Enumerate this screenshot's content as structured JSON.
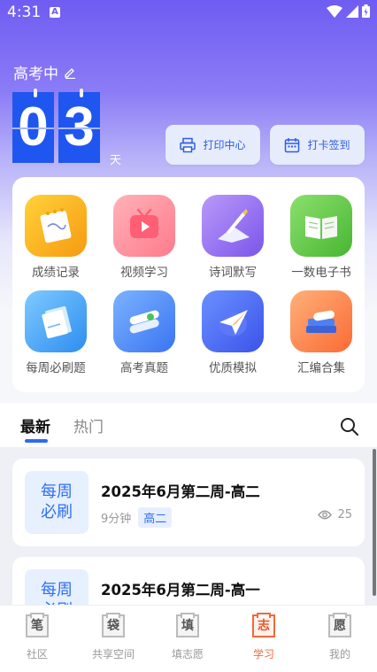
{
  "status_bar": {
    "time": "4:31",
    "notification_glyph": "A"
  },
  "countdown": {
    "title": "高考中",
    "digit_1": "0",
    "digit_2": "3",
    "unit": "天"
  },
  "top_buttons": {
    "print_center": "打印中心",
    "checkin": "打卡签到"
  },
  "grid": {
    "items": [
      {
        "label": "成绩记录",
        "icon": "notepad-icon",
        "color": "#f7b418"
      },
      {
        "label": "视频学习",
        "icon": "tv-play-icon",
        "color": "#ff8a9a"
      },
      {
        "label": "诗词默写",
        "icon": "quill-icon",
        "color": "#9a73f2"
      },
      {
        "label": "一数电子书",
        "icon": "open-book-icon",
        "color": "#5fc44a"
      },
      {
        "label": "每周必刷题",
        "icon": "paper-stack-icon",
        "color": "#3aa6f4"
      },
      {
        "label": "高考真题",
        "icon": "scroll-icon",
        "color": "#3f7ff5"
      },
      {
        "label": "优质模拟",
        "icon": "paper-plane-icon",
        "color": "#4c6ff5"
      },
      {
        "label": "汇编合集",
        "icon": "books-icon",
        "color": "#fb7a45"
      }
    ]
  },
  "tabs": {
    "latest": "最新",
    "hot": "热门"
  },
  "list": [
    {
      "badge": "每周\n必刷",
      "title": "2025年6月第二周-高二",
      "duration": "9分钟",
      "grade": "高二",
      "views": "25"
    },
    {
      "badge": "每周\n必刷",
      "title": "2025年6月第二周-高一"
    }
  ],
  "bottom_nav": {
    "items": [
      {
        "label": "社区",
        "glyph": "笔"
      },
      {
        "label": "共享空间",
        "glyph": "袋"
      },
      {
        "label": "填志愿",
        "glyph": "填"
      },
      {
        "label": "学习",
        "glyph": "志"
      },
      {
        "label": "我的",
        "glyph": "愿"
      }
    ],
    "active_index": 3
  },
  "colors": {
    "accent": "#2f5ce8",
    "nav_active": "#ef6a3f",
    "purple": "#6f5cf2"
  }
}
